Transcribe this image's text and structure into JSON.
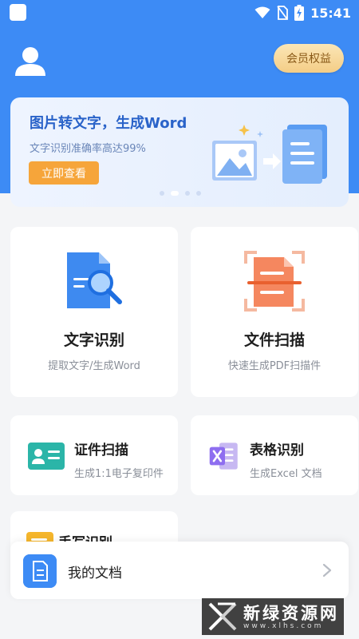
{
  "status_bar": {
    "time": "15:41",
    "icons": [
      "wifi-icon",
      "no-sim-icon",
      "battery-charging-icon"
    ]
  },
  "header": {
    "vip_label": "会员权益",
    "avatar_icon": "user-avatar-icon"
  },
  "banner": {
    "title": "图片转文字，生成Word",
    "subtitle": "文字识别准确率高达99%",
    "button_label": "立即查看",
    "page_count": 4,
    "active_page": 2
  },
  "tools": {
    "text_recognition": {
      "title": "文字识别",
      "desc": "提取文字/生成Word",
      "icon": "text-recognition-icon"
    },
    "doc_scan": {
      "title": "文件扫描",
      "desc": "快速生成PDF扫描件",
      "icon": "document-scan-icon"
    },
    "id_scan": {
      "title": "证件扫描",
      "desc": "生成1:1电子复印件",
      "icon": "id-card-icon"
    },
    "table_recognition": {
      "title": "表格识别",
      "desc": "生成Excel 文档",
      "icon": "excel-icon"
    },
    "handwriting": {
      "title": "手写识别",
      "icon": "handwriting-icon"
    }
  },
  "my_docs": {
    "label": "我的文档",
    "icon": "document-icon"
  },
  "watermark": {
    "text": "新绿资源网",
    "sub": "www.xlhs.com"
  },
  "colors": {
    "primary": "#3d8bf5",
    "accent_orange": "#f6a53a",
    "gold": "#f4cd86"
  }
}
